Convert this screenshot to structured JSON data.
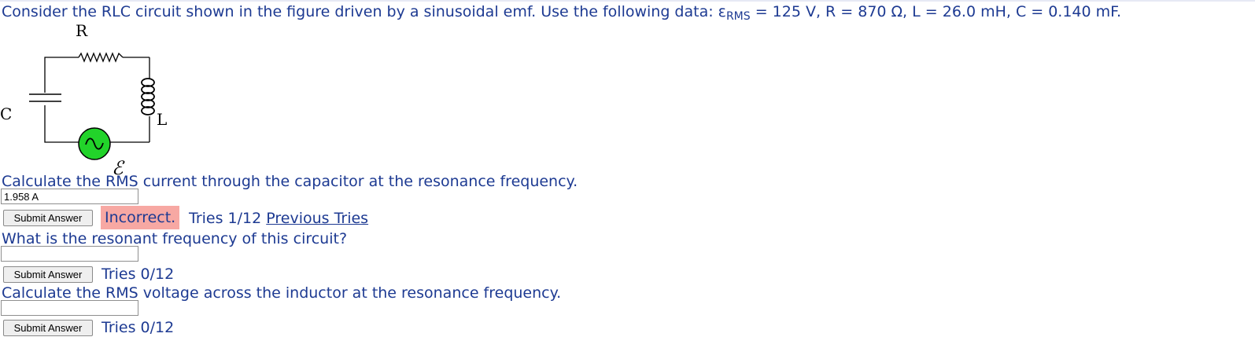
{
  "intro": {
    "text_before": "Consider the RLC circuit shown in the figure driven by a sinusoidal emf. Use the following data: ε",
    "subscript": "RMS",
    "text_after": " = 125 V, R = 870 Ω, L = 26.0 mH, C = 0.140 mF."
  },
  "figure": {
    "label_r": "R",
    "label_c": "C",
    "label_l": "L",
    "label_emf": "ℰ"
  },
  "questions": [
    {
      "prompt": "Calculate the RMS current through the capacitor at the resonance frequency.",
      "answer_value": "1.958 A",
      "submit_label": "Submit Answer",
      "status": "Incorrect.",
      "tries": "Tries 1/12",
      "previous_tries": "Previous Tries"
    },
    {
      "prompt": "What is the resonant frequency of this circuit?",
      "answer_value": "",
      "submit_label": "Submit Answer",
      "tries": "Tries 0/12"
    },
    {
      "prompt": "Calculate the RMS voltage across the inductor at the resonance frequency.",
      "answer_value": "",
      "submit_label": "Submit Answer",
      "tries": "Tries 0/12"
    }
  ],
  "colors": {
    "text": "#1d3a92",
    "incorrect_bg": "#f7a8a3",
    "emf_source": "#22d32a"
  }
}
